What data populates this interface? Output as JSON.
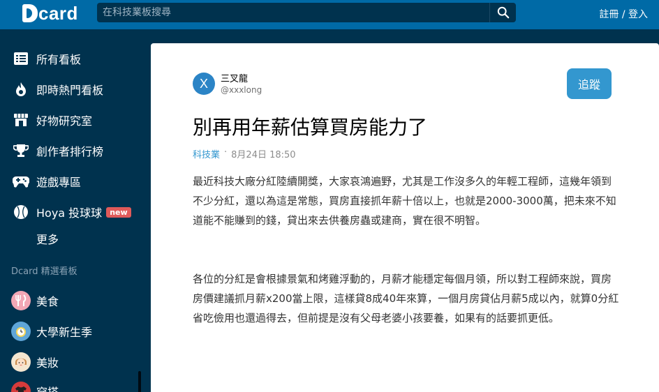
{
  "header": {
    "logo_text": "card",
    "search_placeholder": "在科技業板搜尋",
    "auth_label": "註冊 / 登入"
  },
  "sidebar": {
    "nav_items": [
      {
        "label": "所有看板",
        "icon": "list-icon"
      },
      {
        "label": "即時熱門看板",
        "icon": "fire-icon"
      },
      {
        "label": "好物研究室",
        "icon": "store-icon"
      },
      {
        "label": "創作者排行榜",
        "icon": "trophy-icon"
      },
      {
        "label": "遊戲專區",
        "icon": "gamepad-icon"
      },
      {
        "label": "Hoya 投球球",
        "icon": "baseball-icon",
        "badge": "new"
      },
      {
        "label": "更多"
      }
    ],
    "section_title": "Dcard 精選看板",
    "featured_boards": [
      {
        "label": "美食",
        "icon": "fork-knife-icon",
        "color": "#f2a7b5"
      },
      {
        "label": "大學新生季",
        "icon": "clock-icon",
        "color": "#5fa6d8"
      },
      {
        "label": "美妝",
        "icon": "face-icon",
        "color": "#f4e6d0"
      },
      {
        "label": "穿搭",
        "icon": "shirt-icon",
        "color": "#d63b3b"
      }
    ]
  },
  "post": {
    "author": {
      "initial": "X",
      "name": "三叉龍",
      "handle": "@xxxlong",
      "avatar_color": "#2b84c6"
    },
    "follow_label": "追蹤",
    "title": "別再用年薪估算買房能力了",
    "board": "科技業",
    "separator": "·",
    "timestamp": "8月24日 18:50",
    "paragraphs": [
      "最近科技大廠分紅陸續開獎，大家哀鴻遍野，尤其是工作沒多久的年輕工程師，這幾年領到不少分紅，還以為這是常態，買房直接抓年薪十倍以上，也就是2000-3000萬，把未來不知道能不能賺到的錢，貸出來去供養房蟲或建商，實在很不明智。",
      "各位的分紅是會根據景氣和烤雞浮動的，月薪才能穩定每個月領，所以對工程師來說，買房房價建議抓月薪x200當上限，這樣貸8成40年來算，一個月房貸佔月薪5成以內，就算0分紅省吃儉用也還過得去，但前提是沒有父母老婆小孩要養，如果有的話要抓更低。"
    ]
  },
  "colors": {
    "topbar": "#006aa6",
    "sidebar": "#00324e",
    "accent": "#3397cf",
    "badge": "#e05a5a"
  }
}
